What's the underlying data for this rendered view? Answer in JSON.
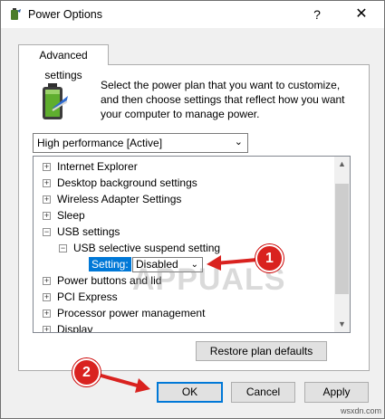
{
  "window": {
    "title": "Power Options",
    "help_glyph": "?",
    "close_glyph": "✕"
  },
  "tab": {
    "label": "Advanced settings"
  },
  "description": "Select the power plan that you want to customize, and then choose settings that reflect how you want your computer to manage power.",
  "plan_select": {
    "value": "High performance [Active]"
  },
  "tree": {
    "items": [
      {
        "expander": "+",
        "label": "Internet Explorer"
      },
      {
        "expander": "+",
        "label": "Desktop background settings"
      },
      {
        "expander": "+",
        "label": "Wireless Adapter Settings"
      },
      {
        "expander": "+",
        "label": "Sleep"
      },
      {
        "expander": "−",
        "label": "USB settings"
      },
      {
        "expander": "−",
        "label": "USB selective suspend setting"
      },
      {
        "expander": "+",
        "label": "Power buttons and lid"
      },
      {
        "expander": "+",
        "label": "PCI Express"
      },
      {
        "expander": "+",
        "label": "Processor power management"
      },
      {
        "expander": "+",
        "label": "Display"
      }
    ],
    "setting_label": "Setting:",
    "setting_value": "Disabled"
  },
  "buttons": {
    "restore": "Restore plan defaults",
    "ok": "OK",
    "cancel": "Cancel",
    "apply": "Apply"
  },
  "markers": {
    "one": "1",
    "two": "2",
    "color": "#d9221f"
  },
  "watermark": {
    "brand": "APPUALS",
    "site": "wsxdn.com"
  }
}
